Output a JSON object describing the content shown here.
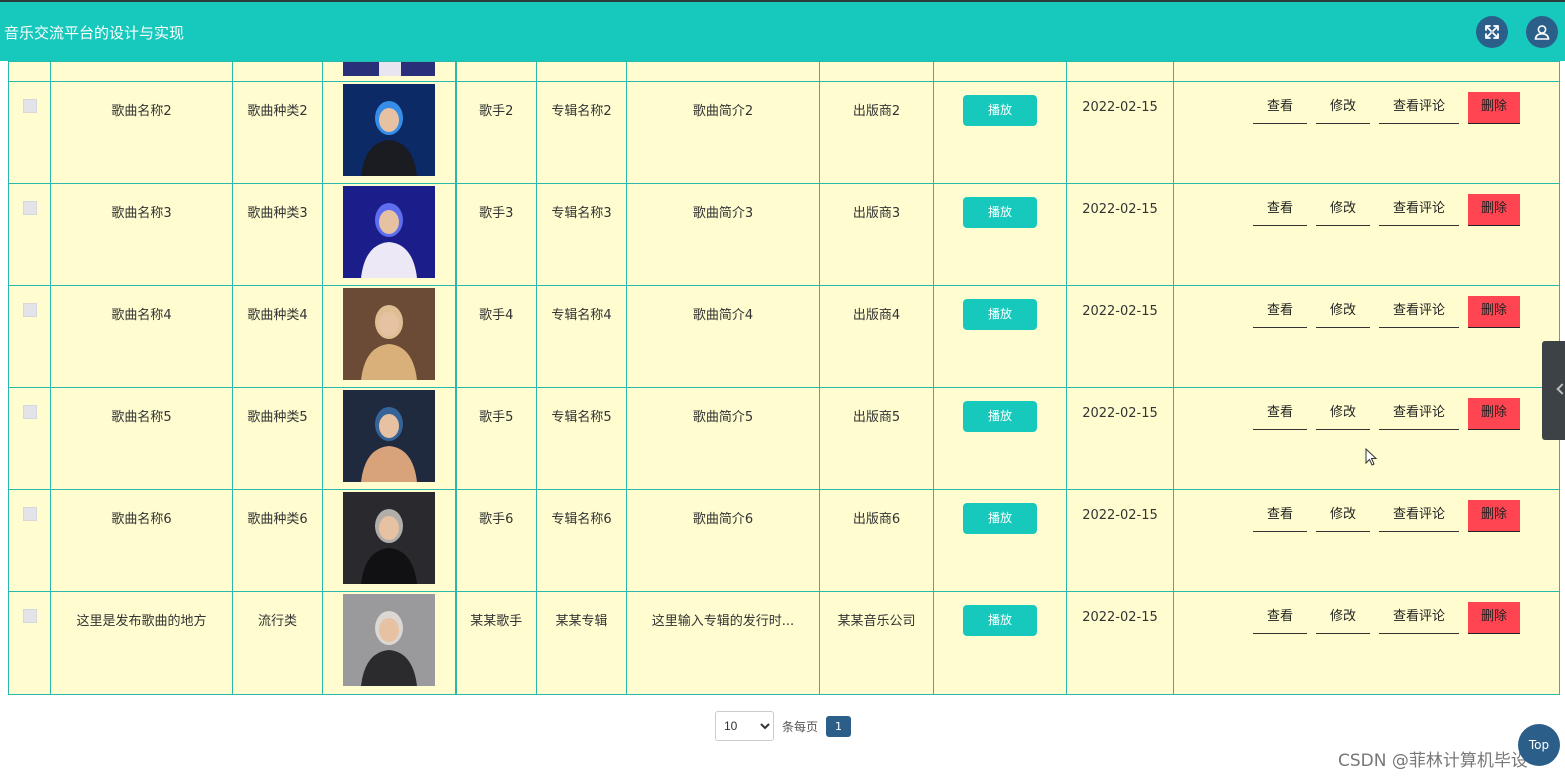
{
  "header": {
    "title": "音乐交流平台的设计与实现",
    "fullscreen_icon": "expand-icon",
    "user_icon": "user-icon",
    "color": "#17c9bc"
  },
  "table": {
    "rows": [
      {
        "name": "歌曲名称2",
        "category": "歌曲种类2",
        "singer": "歌手2",
        "album": "专辑名称2",
        "intro": "歌曲简介2",
        "publisher": "出版商2",
        "play": "播放",
        "date": "2022-02-15"
      },
      {
        "name": "歌曲名称3",
        "category": "歌曲种类3",
        "singer": "歌手3",
        "album": "专辑名称3",
        "intro": "歌曲简介3",
        "publisher": "出版商3",
        "play": "播放",
        "date": "2022-02-15"
      },
      {
        "name": "歌曲名称4",
        "category": "歌曲种类4",
        "singer": "歌手4",
        "album": "专辑名称4",
        "intro": "歌曲简介4",
        "publisher": "出版商4",
        "play": "播放",
        "date": "2022-02-15"
      },
      {
        "name": "歌曲名称5",
        "category": "歌曲种类5",
        "singer": "歌手5",
        "album": "专辑名称5",
        "intro": "歌曲简介5",
        "publisher": "出版商5",
        "play": "播放",
        "date": "2022-02-15"
      },
      {
        "name": "歌曲名称6",
        "category": "歌曲种类6",
        "singer": "歌手6",
        "album": "专辑名称6",
        "intro": "歌曲简介6",
        "publisher": "出版商6",
        "play": "播放",
        "date": "2022-02-15"
      },
      {
        "name": "这里是发布歌曲的地方",
        "category": "流行类",
        "singer": "某某歌手",
        "album": "某某专辑",
        "intro": "这里输入专辑的发行时...",
        "publisher": "某某音乐公司",
        "play": "播放",
        "date": "2022-02-15"
      }
    ],
    "actions": {
      "view": "查看",
      "edit": "修改",
      "comments": "查看评论",
      "delete": "删除"
    },
    "delete_color": "#ff4552"
  },
  "pagination": {
    "page_size": "10",
    "page_size_options": [
      "10"
    ],
    "per_page_label": "条每页",
    "current_page": "1"
  },
  "watermark": "CSDN @菲林计算机毕设",
  "top_button": "Top"
}
